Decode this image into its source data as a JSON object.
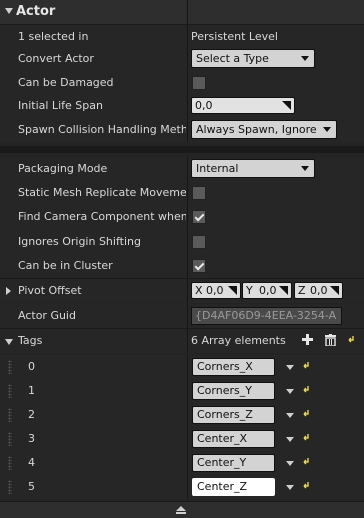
{
  "section": {
    "title": "Actor"
  },
  "rows": {
    "selected": {
      "label": "1 selected in",
      "value": "Persistent Level"
    },
    "convert": {
      "label": "Convert Actor",
      "value": "Select a Type"
    },
    "damaged": {
      "label": "Can be Damaged",
      "checked": false
    },
    "lifespan": {
      "label": "Initial Life Span",
      "value": "0,0"
    },
    "spawn": {
      "label": "Spawn Collision Handling Method",
      "value": "Always Spawn, Ignore Co"
    },
    "packaging": {
      "label": "Packaging Mode",
      "value": "Internal"
    },
    "staticmesh": {
      "label": "Static Mesh Replicate Movement",
      "checked": false
    },
    "findcamera": {
      "label": "Find Camera Component when View Target",
      "checked": true
    },
    "origin": {
      "label": "Ignores Origin Shifting",
      "checked": false
    },
    "cluster": {
      "label": "Can be in Cluster",
      "checked": true
    },
    "pivot": {
      "label": "Pivot Offset",
      "x_label": "X",
      "x": "0,0",
      "y_label": "Y",
      "y": "0,0",
      "z_label": "Z",
      "z": "0,0"
    },
    "guid": {
      "label": "Actor Guid",
      "value": "{D4AF06D9-4EEA-3254-A"
    },
    "tags": {
      "label": "Tags",
      "count": "6 Array elements"
    }
  },
  "tags": [
    {
      "index": "0",
      "value": "Corners_X"
    },
    {
      "index": "1",
      "value": "Corners_Y"
    },
    {
      "index": "2",
      "value": "Corners_Z"
    },
    {
      "index": "3",
      "value": "Center_X"
    },
    {
      "index": "4",
      "value": "Center_Y"
    },
    {
      "index": "5",
      "value": "Center_Z"
    }
  ],
  "colors": {
    "reset_arrow": "#e8d84a",
    "panel_bg": "#242424"
  }
}
